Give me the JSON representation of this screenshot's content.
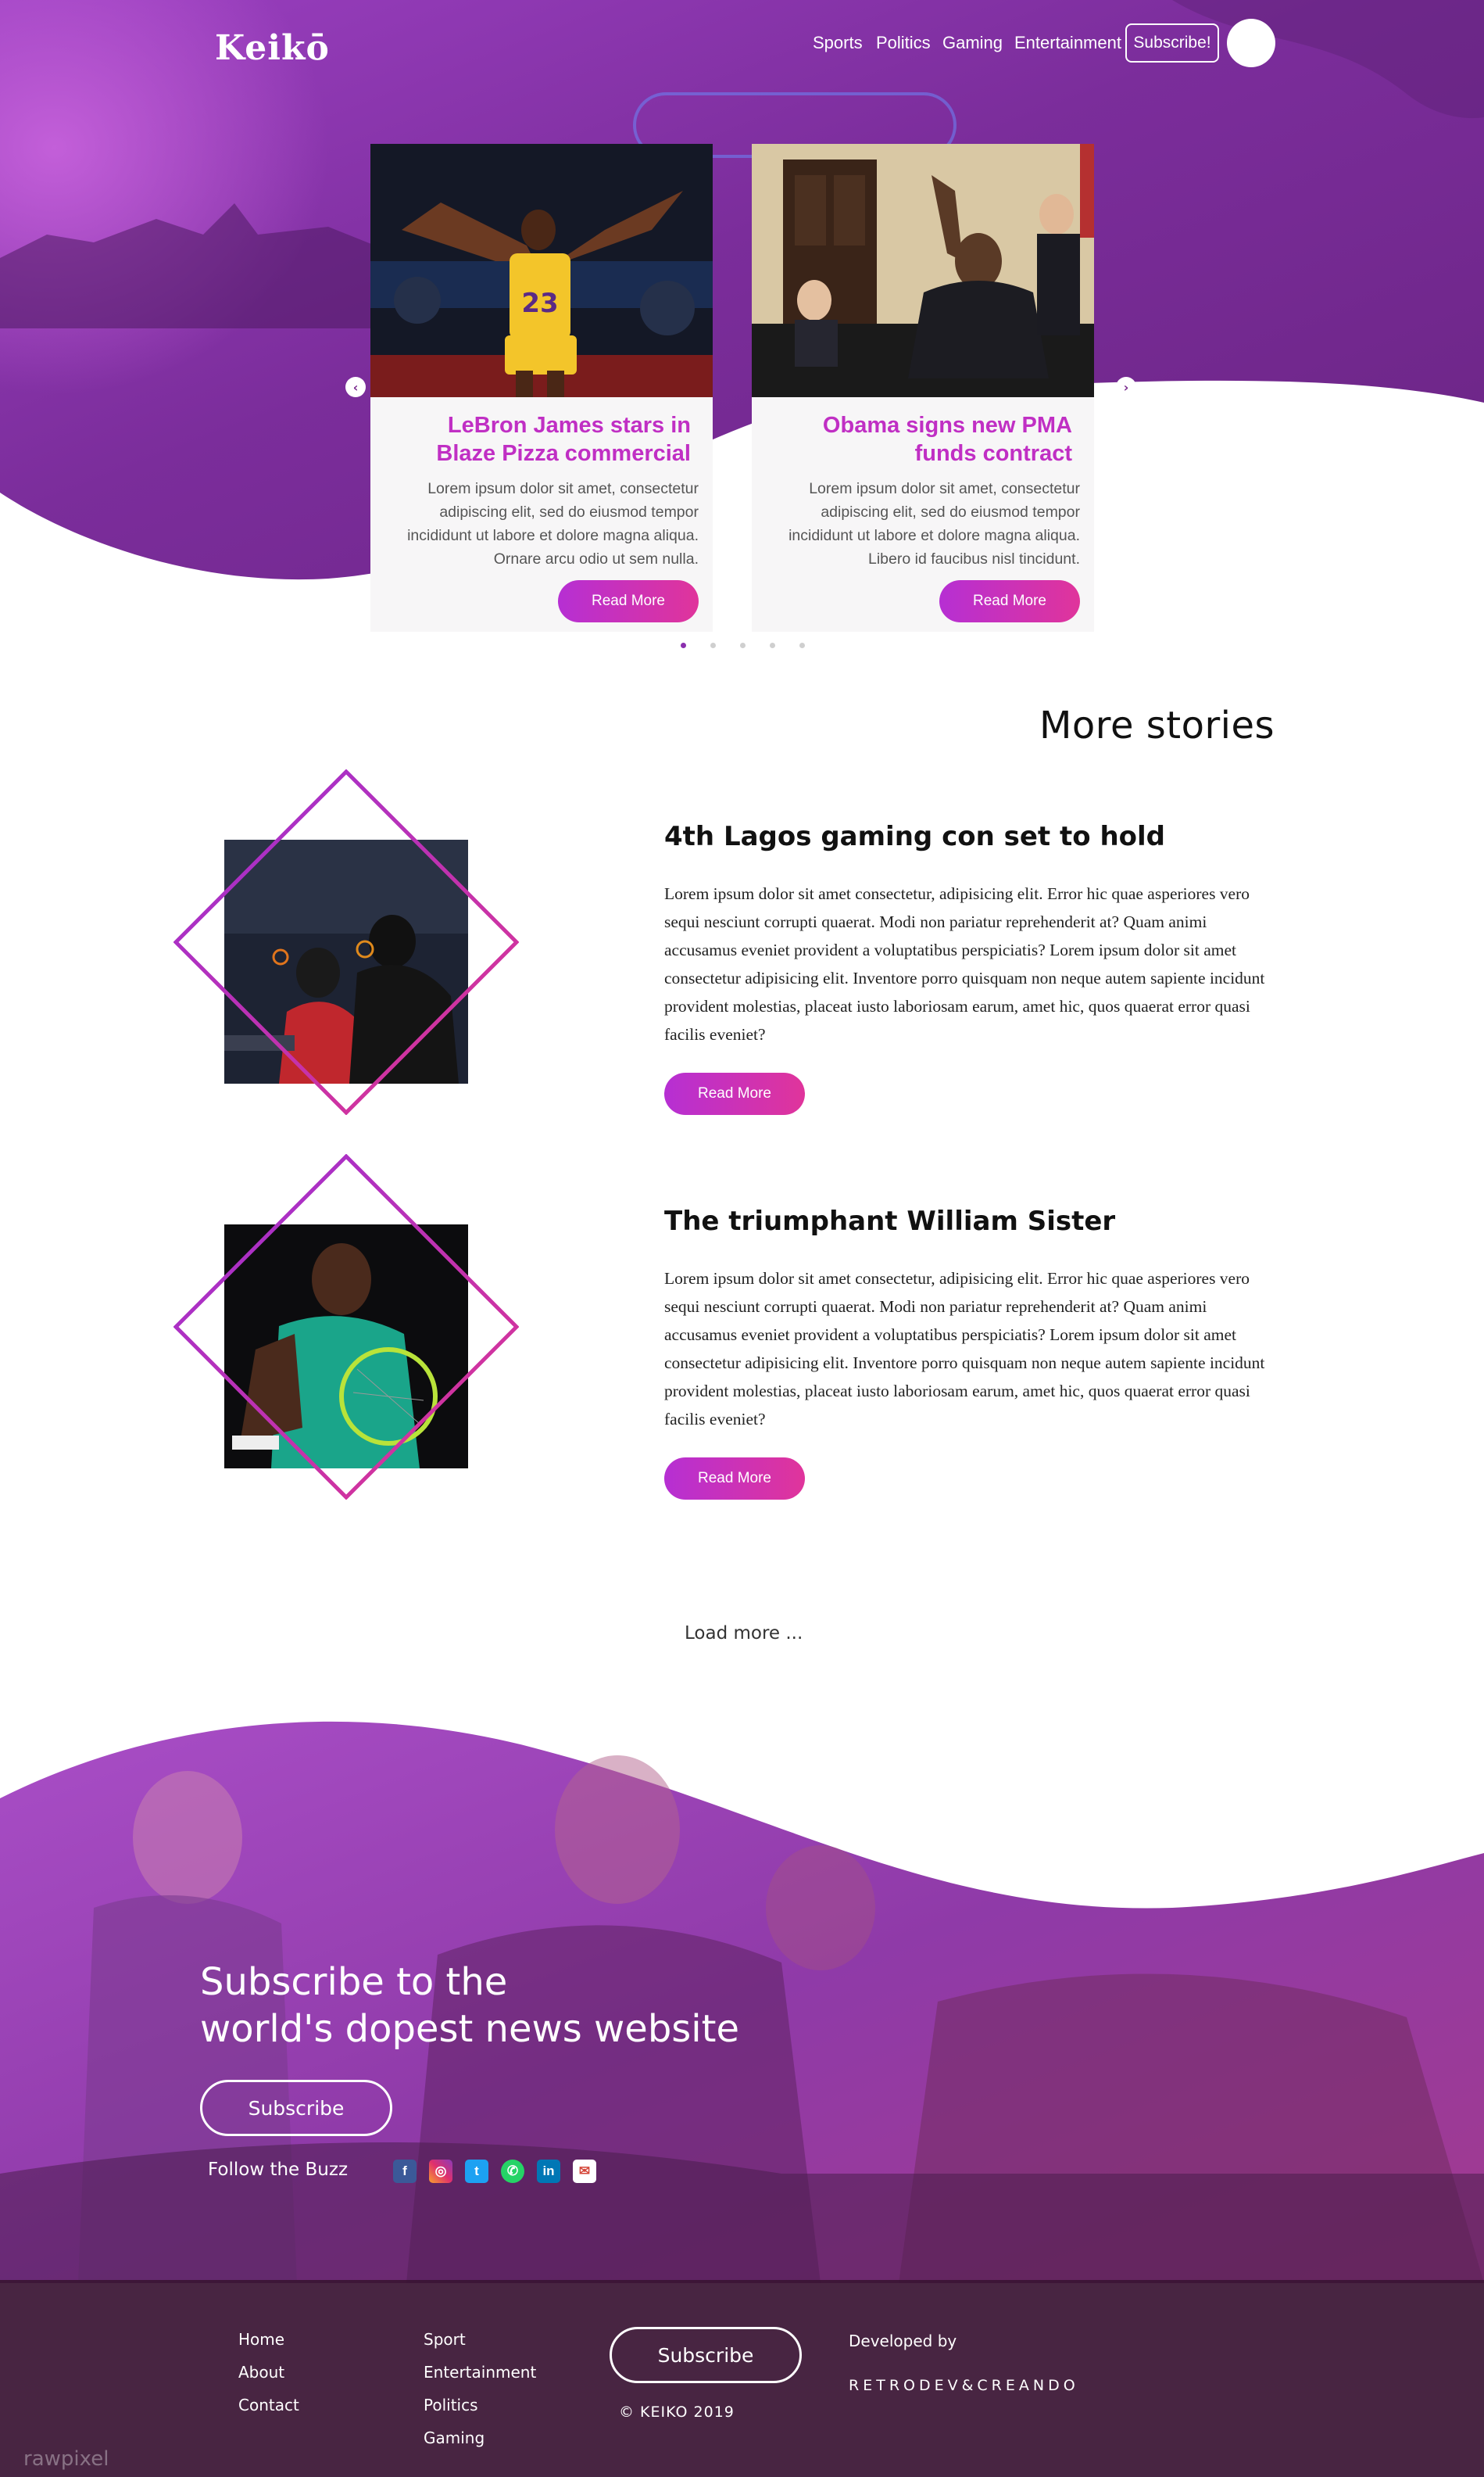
{
  "brand": {
    "logo": "Keikō"
  },
  "nav": {
    "items": [
      "Sports",
      "Politics",
      "Gaming",
      "Entertainment"
    ],
    "subscribe": "Subscribe!"
  },
  "colors": {
    "purple_dark": "#5a1c78",
    "purple": "#8b2fae",
    "magenta": "#c02fc4",
    "pink": "#e0349b",
    "footer": "#3a1434"
  },
  "carousel": {
    "prev_icon": "chevron-left-icon",
    "next_icon": "chevron-right-icon",
    "cards": [
      {
        "title": "LeBron James stars in Blaze Pizza commercial",
        "text": "Lorem ipsum dolor sit amet, consectetur adipiscing elit, sed do eiusmod tempor incididunt ut labore et dolore magna aliqua. Ornare arcu odio ut sem nulla.",
        "button": "Read More",
        "image_caption": "23"
      },
      {
        "title": "Obama signs new PMA funds contract",
        "text": "Lorem ipsum dolor sit amet, consectetur adipiscing elit, sed do eiusmod tempor incididunt ut labore et dolore magna aliqua. Libero id faucibus nisl tincidunt.",
        "button": "Read More"
      }
    ],
    "dots": 5,
    "active_dot": 0
  },
  "more": {
    "title": "More stories",
    "stories": [
      {
        "title": "4th Lagos gaming con set to hold",
        "body": "Lorem ipsum dolor sit amet consectetur, adipisicing elit. Error hic quae asperiores vero sequi nesciunt corrupti quaerat. Modi non pariatur reprehenderit at? Quam animi accusamus eveniet provident a voluptatibus perspiciatis? Lorem ipsum dolor sit amet consectetur adipisicing elit. Inventore porro quisquam non neque autem sapiente incidunt provident molestias, placeat iusto laboriosam earum, amet hic, quos quaerat error quasi facilis eveniet?",
        "button": "Read More"
      },
      {
        "title": "The triumphant William Sister",
        "body": "Lorem ipsum dolor sit amet consectetur, adipisicing elit. Error hic quae asperiores vero sequi nesciunt corrupti quaerat. Modi non pariatur reprehenderit at? Quam animi accusamus eveniet provident a voluptatibus perspiciatis? Lorem ipsum dolor sit amet consectetur adipisicing elit. Inventore porro quisquam non neque autem sapiente incidunt provident molestias, placeat iusto laboriosam earum, amet hic, quos quaerat error quasi facilis eveniet?",
        "button": "Read More"
      }
    ],
    "load_more": "Load more ..."
  },
  "subscribe_section": {
    "title_line1": "Subscribe to the",
    "title_line2": "world's dopest news website",
    "button": "Subscribe",
    "follow": "Follow the Buzz",
    "social": [
      "facebook-icon",
      "instagram-icon",
      "twitter-icon",
      "whatsapp-icon",
      "linkedin-icon",
      "mail-icon"
    ]
  },
  "footer": {
    "col1": [
      "Home",
      "About",
      "Contact"
    ],
    "col2": [
      "Sport",
      "Entertainment",
      "Politics",
      "Gaming"
    ],
    "button": "Subscribe",
    "copyright": "© KEIKO 2019",
    "developed_by": "Developed by",
    "developer": "RETRODEV&CREANDO",
    "watermark": "rawpixel"
  }
}
